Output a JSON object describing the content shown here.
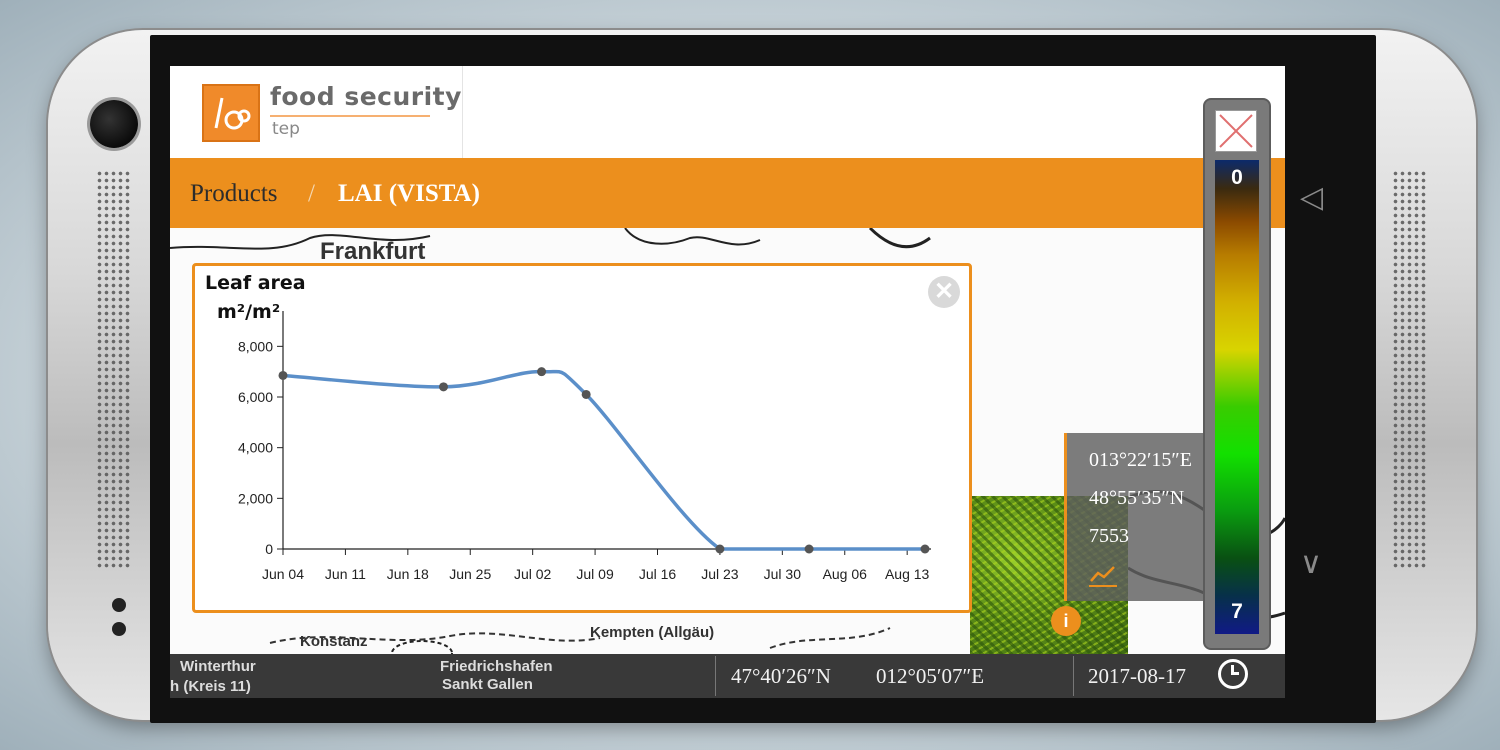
{
  "app": {
    "logo_title": "food security",
    "logo_subtitle": "tep"
  },
  "breadcrumb": {
    "root": "Products",
    "separator": "/",
    "current": "LAI (VISTA)"
  },
  "map": {
    "labels": {
      "frankfurt": "Frankfurt",
      "konstanz": "Konstanz",
      "kempten": "Kempten (Allgäu)",
      "friedrichshafen": "Friedrichshafen",
      "winterthur": "Winterthur",
      "sankt_gallen": "Sankt Gallen",
      "kreis": "h (Kreis 11)"
    }
  },
  "popup": {
    "longitude": "013°22′15″E",
    "latitude": "48°55′35″N",
    "value": "7553",
    "chart_icon": "chart-icon"
  },
  "info_marker": "i",
  "chart_dialog": {
    "title": "Leaf area",
    "unit": "m²/m²",
    "close_symbol": "✕"
  },
  "chart_data": {
    "type": "line",
    "ylabel": "m²/m²",
    "ylim": [
      0,
      9000
    ],
    "yticks": [
      "0",
      "2,000",
      "4,000",
      "6,000",
      "8,000"
    ],
    "ytick_values": [
      0,
      2000,
      4000,
      6000,
      8000
    ],
    "xticks": [
      "Jun 04",
      "Jun 11",
      "Jun 18",
      "Jun 25",
      "Jul 02",
      "Jul 09",
      "Jul 16",
      "Jul 23",
      "Jul 30",
      "Aug 06",
      "Aug 13"
    ],
    "xlim_days": [
      0,
      72
    ],
    "series": [
      {
        "color": "#5b8fc9",
        "points": [
          {
            "date": "Jun 04",
            "value": 6850
          },
          {
            "date": "Jun 22",
            "value": 6400
          },
          {
            "date": "Jul 03",
            "value": 7000
          },
          {
            "date": "Jul 08",
            "value": 6100
          },
          {
            "date": "Jul 23",
            "value": 0
          },
          {
            "date": "Aug 02",
            "value": 0
          },
          {
            "date": "Aug 15",
            "value": 0
          }
        ]
      }
    ]
  },
  "footer": {
    "latitude": "47°40′26″N",
    "longitude": "012°05′07″E",
    "date": "2017-08-17"
  },
  "legend": {
    "top_label": "0",
    "bottom_label": "7"
  },
  "colors": {
    "accent": "#ec8f1d",
    "line": "#5b8fc9"
  }
}
